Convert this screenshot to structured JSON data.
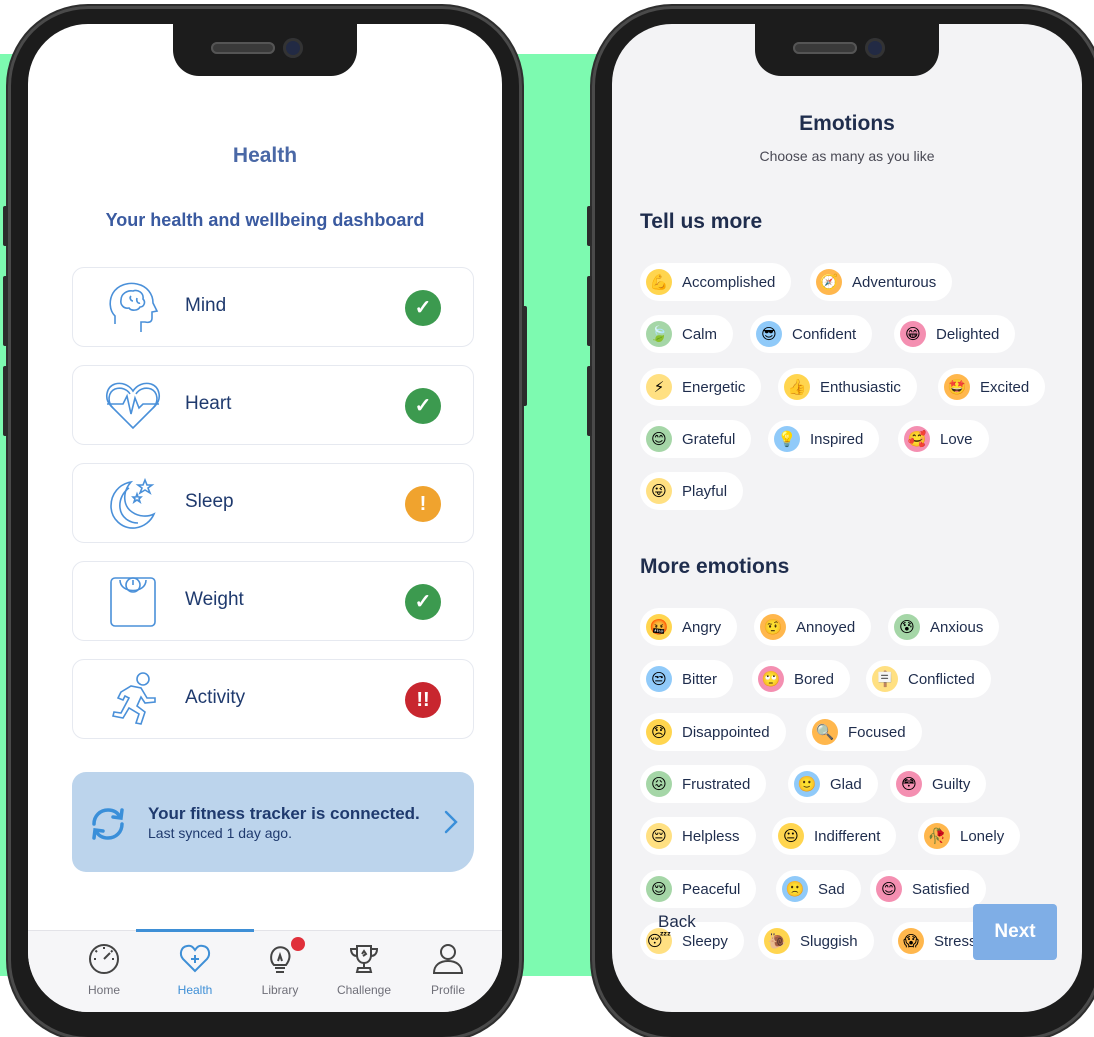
{
  "health": {
    "title": "Health",
    "subtitle": "Your health and wellbeing dashboard",
    "cards": [
      {
        "label": "Mind",
        "status": "ok",
        "status_glyph": "✓"
      },
      {
        "label": "Heart",
        "status": "ok",
        "status_glyph": "✓"
      },
      {
        "label": "Sleep",
        "status": "warning",
        "status_glyph": "!"
      },
      {
        "label": "Weight",
        "status": "ok",
        "status_glyph": "✓"
      },
      {
        "label": "Activity",
        "status": "alert",
        "status_glyph": "!!"
      }
    ],
    "tracker": {
      "title": "Your fitness tracker is connected.",
      "subtitle": "Last synced 1 day ago."
    },
    "tabs": [
      {
        "label": "Home",
        "icon": "speedometer-icon"
      },
      {
        "label": "Health",
        "icon": "heart-plus-icon",
        "active": true
      },
      {
        "label": "Library",
        "icon": "lightbulb-icon",
        "badge": true
      },
      {
        "label": "Challenge",
        "icon": "trophy-icon"
      },
      {
        "label": "Profile",
        "icon": "person-icon"
      }
    ]
  },
  "emotions": {
    "title": "Emotions",
    "subtitle": "Choose as many as you like",
    "section_more": "Tell us more",
    "section_other": "More emotions",
    "tell_us_more": [
      {
        "label": "Accomplished",
        "emoji": "💪"
      },
      {
        "label": "Adventurous",
        "emoji": "🧭"
      },
      {
        "label": "Calm",
        "emoji": "🍃"
      },
      {
        "label": "Confident",
        "emoji": "😎"
      },
      {
        "label": "Delighted",
        "emoji": "😁"
      },
      {
        "label": "Energetic",
        "emoji": "⚡"
      },
      {
        "label": "Enthusiastic",
        "emoji": "👍"
      },
      {
        "label": "Excited",
        "emoji": "🤩"
      },
      {
        "label": "Grateful",
        "emoji": "😊"
      },
      {
        "label": "Inspired",
        "emoji": "💡"
      },
      {
        "label": "Love",
        "emoji": "🥰"
      },
      {
        "label": "Playful",
        "emoji": "😜"
      }
    ],
    "more_emotions": [
      {
        "label": "Angry",
        "emoji": "🤬"
      },
      {
        "label": "Annoyed",
        "emoji": "🤨"
      },
      {
        "label": "Anxious",
        "emoji": "😰"
      },
      {
        "label": "Bitter",
        "emoji": "😒"
      },
      {
        "label": "Bored",
        "emoji": "🙄"
      },
      {
        "label": "Conflicted",
        "emoji": "🪧"
      },
      {
        "label": "Disappointed",
        "emoji": "😞"
      },
      {
        "label": "Focused",
        "emoji": "🔍"
      },
      {
        "label": "Frustrated",
        "emoji": "😖"
      },
      {
        "label": "Glad",
        "emoji": "🙂"
      },
      {
        "label": "Guilty",
        "emoji": "😳"
      },
      {
        "label": "Helpless",
        "emoji": "😔"
      },
      {
        "label": "Indifferent",
        "emoji": "😐"
      },
      {
        "label": "Lonely",
        "emoji": "🥀"
      },
      {
        "label": "Peaceful",
        "emoji": "😌"
      },
      {
        "label": "Sad",
        "emoji": "🙁"
      },
      {
        "label": "Satisfied",
        "emoji": "😊"
      },
      {
        "label": "Sleepy",
        "emoji": "😴"
      },
      {
        "label": "Sluggish",
        "emoji": "🐌"
      },
      {
        "label": "Stressed",
        "emoji": "😱"
      }
    ],
    "back_label": "Back",
    "next_label": "Next"
  },
  "colors": {
    "backdrop_green": "#7dfab0",
    "accent_blue": "#3e8fd6",
    "ok_green": "#3c9a4f",
    "warning_orange": "#f0a32e",
    "alert_red": "#c8262f",
    "next_button": "#7faee6"
  }
}
